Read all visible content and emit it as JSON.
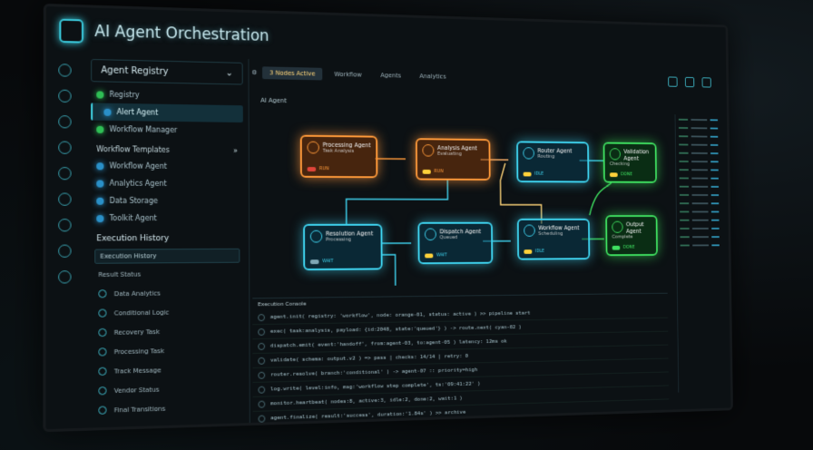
{
  "app": {
    "title": "AI Agent Orchestration"
  },
  "sidebar": {
    "header": "Agent Registry",
    "items": [
      {
        "label": "Registry"
      },
      {
        "label": "Alert Agent"
      },
      {
        "label": "Workflow Manager"
      }
    ],
    "section1": "Workflow Templates",
    "templates": [
      {
        "label": "Workflow Agent"
      },
      {
        "label": "Analytics Agent"
      },
      {
        "label": "Data Storage"
      },
      {
        "label": "Toolkit Agent"
      }
    ],
    "section2": "Execution History",
    "select_value": "Execution History",
    "history_label": "Result Status",
    "history": [
      {
        "label": "Data Analytics"
      },
      {
        "label": "Conditional Logic"
      },
      {
        "label": "Recovery Task"
      },
      {
        "label": "Processing Task"
      },
      {
        "label": "Track Message"
      },
      {
        "label": "Vendor Status"
      },
      {
        "label": "Final Transitions"
      }
    ]
  },
  "toolbar": {
    "tabs": [
      {
        "label": "3 Nodes Active"
      },
      {
        "label": "Workflow"
      },
      {
        "label": "Agents"
      },
      {
        "label": "Analytics"
      }
    ]
  },
  "breadcrumb": "AI Agent",
  "nodes": [
    {
      "title": "Processing Agent",
      "sub": "Task Analysis",
      "status": "RUN",
      "color": "orange"
    },
    {
      "title": "Analysis Agent",
      "sub": "Evaluating",
      "status": "RUN",
      "color": "orange"
    },
    {
      "title": "Router Agent",
      "sub": "Routing",
      "status": "IDLE",
      "color": "cyan"
    },
    {
      "title": "Validation Agent",
      "sub": "Checking",
      "status": "DONE",
      "color": "green"
    },
    {
      "title": "Resolution Agent",
      "sub": "Processing",
      "status": "WAIT",
      "color": "cyan"
    },
    {
      "title": "Dispatch Agent",
      "sub": "Queued",
      "status": "WAIT",
      "color": "cyan"
    },
    {
      "title": "Workflow Agent",
      "sub": "Scheduling",
      "status": "IDLE",
      "color": "cyan"
    },
    {
      "title": "Output Agent",
      "sub": "Complete",
      "status": "DONE",
      "color": "green"
    }
  ],
  "log": {
    "title": "Execution Console",
    "rows": [
      {
        "text": "agent.init( registry: 'workflow', node: orange-01, status: active )  >> pipeline start"
      },
      {
        "text": "exec( task:analysis, payload: {id:2048, state:'queued'} ) -> route.next( cyan-02 )"
      },
      {
        "text": "dispatch.emit( event:'handoff', from:agent-03, to:agent-05 )  latency: 12ms  ok"
      },
      {
        "text": "validate( schema: output.v2 ) => pass  | checks: 14/14  | retry: 0"
      },
      {
        "text": "router.resolve( branch:'conditional' ) -> agent-07 :: priority=high"
      },
      {
        "text": "log.write( level:info, msg:'workflow step complete', ts:'09:41:22' )"
      },
      {
        "text": "monitor.heartbeat( nodes:8, active:3, idle:2, done:2, wait:1 )"
      },
      {
        "text": "agent.finalize( result:'success', duration:'1.84s' ) >> archive"
      }
    ]
  },
  "colors": {
    "orange": "#ff9a3a",
    "cyan": "#3fd4f0",
    "green": "#3fe060",
    "accent": "#3fb6c6"
  }
}
